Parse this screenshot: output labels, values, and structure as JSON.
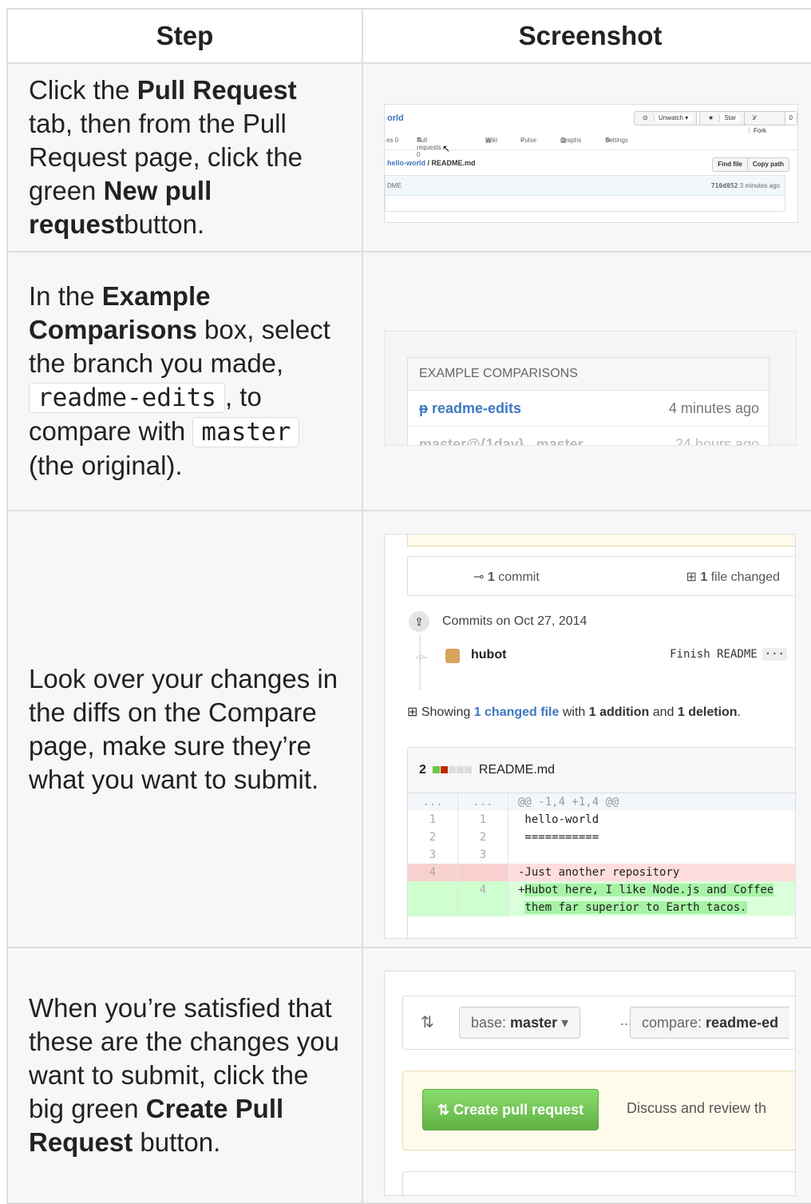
{
  "headers": {
    "step": "Step",
    "screenshot": "Screenshot"
  },
  "rows": [
    {
      "parts": [
        {
          "t": "Click the "
        },
        {
          "b": "Pull Request"
        },
        {
          "t": " tab, then from the Pull Request page, click the green "
        },
        {
          "b": "New pull request"
        },
        {
          "t": "button."
        }
      ]
    },
    {
      "parts": [
        {
          "t": "In the "
        },
        {
          "b": "Example Comparisons"
        },
        {
          "t": " box, select the branch you made, "
        },
        {
          "c": "readme-edits"
        },
        {
          "t": ", to compare with "
        },
        {
          "c": "master"
        },
        {
          "t": " (the original)."
        }
      ]
    },
    {
      "parts": [
        {
          "t": "Look over your changes in the diffs on the Compare page, make sure they’re what you want to submit."
        }
      ]
    },
    {
      "parts": [
        {
          "t": "When you’re satisfied that these are the changes you want to submit, click the big green "
        },
        {
          "b": "Create Pull Request"
        },
        {
          "t": " button."
        }
      ]
    }
  ],
  "shot1": {
    "repo": "orld",
    "unwatch": "Unwatch ▾",
    "unwatch_count": "1",
    "star": "Star",
    "star_count": "0",
    "fork": "Fork",
    "fork_count": "0",
    "tabs": [
      "es 0",
      "Pull requests 0",
      "Wiki",
      "Pulse",
      "Graphs",
      "Settings"
    ],
    "path_link": "hello-world",
    "path_file": " / README.md",
    "find_file": "Find file",
    "copy_path": "Copy path",
    "file_left": "DME",
    "commit_hash": "710d852",
    "commit_time": " 3 minutes ago"
  },
  "shot2": {
    "header": "EXAMPLE COMPARISONS",
    "items": [
      {
        "name": "readme-edits",
        "time": "4 minutes ago"
      },
      {
        "name": "master@{1day}...master",
        "time": "24 hours ago"
      }
    ]
  },
  "shot3": {
    "commits_count": "1",
    "commits_label": " commit",
    "files_count": "1",
    "files_label": " file changed",
    "commits_on": "Commits on Oct 27, 2014",
    "author": "hubot",
    "message": "Finish README",
    "show_1": "Showing ",
    "show_link": "1 changed file",
    "show_2": " with ",
    "additions": "1 addition",
    "show_3": " and ",
    "deletions": "1 deletion",
    "show_4": ".",
    "file_count": "2",
    "file_name": "README.md",
    "lines": [
      {
        "k": "hunk",
        "a": "...",
        "b": "...",
        "c": "@@ -1,4 +1,4 @@"
      },
      {
        "k": "ctx",
        "a": "1",
        "b": "1",
        "c": " hello-world"
      },
      {
        "k": "ctx",
        "a": "2",
        "b": "2",
        "c": " ==========="
      },
      {
        "k": "ctx",
        "a": "3",
        "b": "3",
        "c": ""
      },
      {
        "k": "del",
        "a": "4",
        "b": "",
        "c": "-Just another repository"
      },
      {
        "k": "add",
        "a": "",
        "b": "4",
        "c": "+Hubot here, I like Node.js and Coffee"
      },
      {
        "k": "add",
        "a": "",
        "b": "",
        "c": " them far superior to Earth tacos."
      }
    ]
  },
  "shot4": {
    "base_label": "base: ",
    "base_value": "master",
    "dots": "...",
    "compare_label": "compare: ",
    "compare_value": "readme-ed",
    "create_button": "Create pull request",
    "discuss": "Discuss and review th"
  }
}
